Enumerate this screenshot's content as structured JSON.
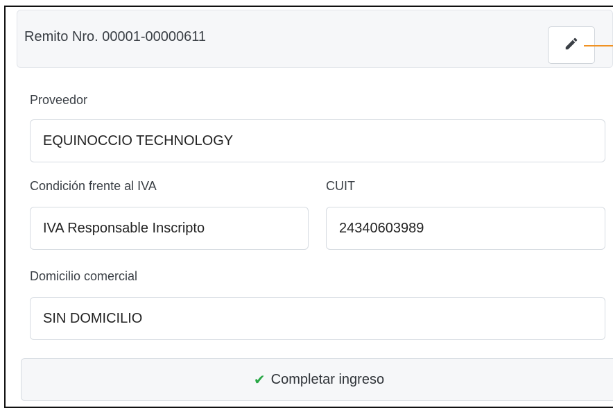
{
  "header": {
    "title": "Remito Nro. 00001-00000611",
    "edit_icon": "pencil-icon"
  },
  "form": {
    "proveedor": {
      "label": "Proveedor",
      "value": "EQUINOCCIO TECHNOLOGY"
    },
    "iva": {
      "label": "Condición frente al IVA",
      "value": "IVA Responsable Inscripto"
    },
    "cuit": {
      "label": "CUIT",
      "value": "24340603989"
    },
    "domicilio": {
      "label": "Domicilio comercial",
      "value": "SIN DOMICILIO"
    }
  },
  "actions": {
    "complete_label": "Completar ingreso",
    "complete_icon": "check-icon"
  },
  "colors": {
    "accent_check": "#28a745",
    "annotation_orange": "#f09223"
  }
}
